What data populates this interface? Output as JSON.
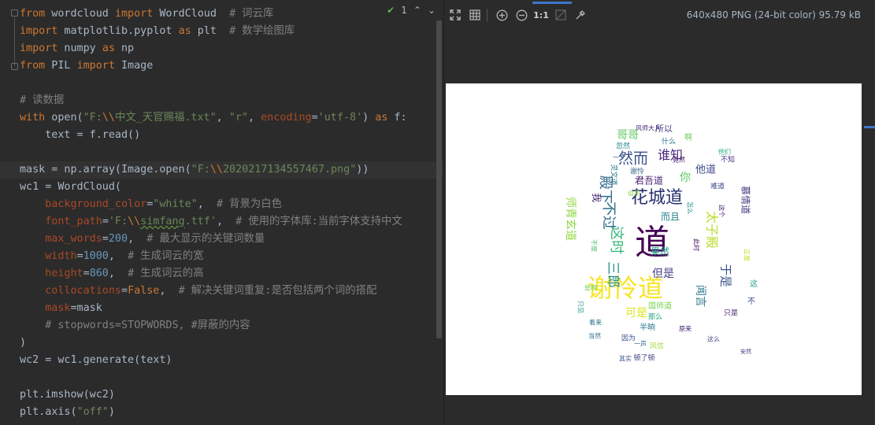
{
  "editor": {
    "code_lines": [
      [
        {
          "t": "from",
          "c": "k"
        },
        {
          "t": " wordcloud ",
          "c": ""
        },
        {
          "t": "import",
          "c": "k"
        },
        {
          "t": " WordCloud  ",
          "c": ""
        },
        {
          "t": "# 词云库",
          "c": "c"
        }
      ],
      [
        {
          "t": "import",
          "c": "k"
        },
        {
          "t": " matplotlib.pyplot ",
          "c": ""
        },
        {
          "t": "as",
          "c": "k"
        },
        {
          "t": " plt  ",
          "c": ""
        },
        {
          "t": "# 数学绘图库",
          "c": "c"
        }
      ],
      [
        {
          "t": "import",
          "c": "k"
        },
        {
          "t": " numpy ",
          "c": ""
        },
        {
          "t": "as",
          "c": "k"
        },
        {
          "t": " np",
          "c": ""
        }
      ],
      [
        {
          "t": "from",
          "c": "k"
        },
        {
          "t": " PIL ",
          "c": ""
        },
        {
          "t": "import",
          "c": "k"
        },
        {
          "t": " Image",
          "c": ""
        }
      ],
      [],
      [
        {
          "t": "# 读数据",
          "c": "c"
        }
      ],
      [
        {
          "t": "with",
          "c": "k"
        },
        {
          "t": " open(",
          "c": ""
        },
        {
          "t": "\"F:",
          "c": "s"
        },
        {
          "t": "\\\\",
          "c": "k"
        },
        {
          "t": "中文_天官赐福.txt\"",
          "c": "s"
        },
        {
          "t": ", ",
          "c": ""
        },
        {
          "t": "\"r\"",
          "c": "s"
        },
        {
          "t": ", ",
          "c": ""
        },
        {
          "t": "encoding",
          "c": "p"
        },
        {
          "t": "=",
          "c": ""
        },
        {
          "t": "'utf-8'",
          "c": "s"
        },
        {
          "t": ") ",
          "c": ""
        },
        {
          "t": "as",
          "c": "k"
        },
        {
          "t": " f:",
          "c": ""
        }
      ],
      [
        {
          "t": "    text = f.read()",
          "c": ""
        }
      ],
      [],
      [
        {
          "t": "mask = np.array(Image.open(",
          "c": ""
        },
        {
          "t": "\"F:",
          "c": "s"
        },
        {
          "t": "\\\\",
          "c": "k"
        },
        {
          "t": "2020217134557467.png\"",
          "c": "s"
        },
        {
          "t": "))",
          "c": ""
        }
      ],
      [
        {
          "t": "wc1 = WordCloud(",
          "c": ""
        }
      ],
      [
        {
          "t": "    ",
          "c": ""
        },
        {
          "t": "background_color",
          "c": "p"
        },
        {
          "t": "=",
          "c": ""
        },
        {
          "t": "\"white\"",
          "c": "s"
        },
        {
          "t": ",  ",
          "c": ""
        },
        {
          "t": "# 背景为白色",
          "c": "c"
        }
      ],
      [
        {
          "t": "    ",
          "c": ""
        },
        {
          "t": "font_path",
          "c": "p"
        },
        {
          "t": "=",
          "c": ""
        },
        {
          "t": "'F:",
          "c": "s"
        },
        {
          "t": "\\\\",
          "c": "k"
        },
        {
          "t": "simfang",
          "c": "su"
        },
        {
          "t": ".ttf'",
          "c": "s"
        },
        {
          "t": ",  ",
          "c": ""
        },
        {
          "t": "# 使用的字体库:当前字体支持中文",
          "c": "c"
        }
      ],
      [
        {
          "t": "    ",
          "c": ""
        },
        {
          "t": "max_words",
          "c": "p"
        },
        {
          "t": "=",
          "c": ""
        },
        {
          "t": "200",
          "c": "n"
        },
        {
          "t": ",  ",
          "c": ""
        },
        {
          "t": "# 最大显示的关键词数量",
          "c": "c"
        }
      ],
      [
        {
          "t": "    ",
          "c": ""
        },
        {
          "t": "width",
          "c": "p"
        },
        {
          "t": "=",
          "c": ""
        },
        {
          "t": "1000",
          "c": "n"
        },
        {
          "t": ",  ",
          "c": ""
        },
        {
          "t": "# 生成词云的宽",
          "c": "c"
        }
      ],
      [
        {
          "t": "    ",
          "c": ""
        },
        {
          "t": "height",
          "c": "p"
        },
        {
          "t": "=",
          "c": ""
        },
        {
          "t": "860",
          "c": "n"
        },
        {
          "t": ",  ",
          "c": ""
        },
        {
          "t": "# 生成词云的高",
          "c": "c"
        }
      ],
      [
        {
          "t": "    ",
          "c": ""
        },
        {
          "t": "collocations",
          "c": "p"
        },
        {
          "t": "=",
          "c": ""
        },
        {
          "t": "False",
          "c": "k"
        },
        {
          "t": ",  ",
          "c": ""
        },
        {
          "t": "# 解决关键词重复:是否包括两个词的搭配",
          "c": "c"
        }
      ],
      [
        {
          "t": "    ",
          "c": ""
        },
        {
          "t": "mask",
          "c": "p"
        },
        {
          "t": "=mask",
          "c": ""
        }
      ],
      [
        {
          "t": "    # stopwords=STOPWORDS, #屏蔽的内容",
          "c": "c"
        }
      ],
      [
        {
          "t": ")",
          "c": ""
        }
      ],
      [
        {
          "t": "wc2 = wc1.generate(text)",
          "c": ""
        }
      ],
      [],
      [
        {
          "t": "plt.imshow(wc2)",
          "c": ""
        }
      ],
      [
        {
          "t": "plt.axis(",
          "c": ""
        },
        {
          "t": "\"off\"",
          "c": "s"
        },
        {
          "t": ")",
          "c": ""
        }
      ]
    ],
    "inspection_count": "1"
  },
  "viewer": {
    "image_info": "640x480 PNG (24-bit color) 95.79 kB",
    "zoom_actual_label": "1:1",
    "wordcloud_words": [
      {
        "t": "道",
        "s": 44,
        "color": "#440154"
      },
      {
        "t": "谢怜道",
        "s": 32,
        "color": "#f7e425"
      },
      {
        "t": "花城道",
        "s": 22,
        "color": "#26306f"
      },
      {
        "t": "然而",
        "s": 19,
        "color": "#3b528b"
      },
      {
        "t": "不过",
        "s": 18,
        "color": "#2c718e"
      },
      {
        "t": "这时",
        "s": 18,
        "color": "#35b779"
      },
      {
        "t": "殿下",
        "s": 18,
        "color": "#31688e"
      },
      {
        "t": "谁知",
        "s": 16,
        "color": "#472a7a"
      },
      {
        "t": "太子殿",
        "s": 16,
        "color": "#b5de2b"
      },
      {
        "t": "三郎",
        "s": 17,
        "color": "#21918c"
      },
      {
        "t": "师青玄道",
        "s": 14,
        "color": "#90d743"
      },
      {
        "t": "哥哥",
        "s": 14,
        "color": "#5ec962"
      },
      {
        "t": "君吾道",
        "s": 12,
        "color": "#482173"
      },
      {
        "t": "于是",
        "s": 15,
        "color": "#3b528b"
      },
      {
        "t": "闻言",
        "s": 14,
        "color": "#2a788e"
      },
      {
        "t": "但是",
        "s": 14,
        "color": "#433e85"
      },
      {
        "t": "可是",
        "s": 14,
        "color": "#dde318"
      },
      {
        "t": "而且",
        "s": 12,
        "color": "#26828e"
      },
      {
        "t": "你",
        "s": 14,
        "color": "#5ec962"
      },
      {
        "t": "我",
        "s": 12,
        "color": "#482878"
      },
      {
        "t": "他道",
        "s": 13,
        "color": "#3e4989"
      },
      {
        "t": "果然",
        "s": 12,
        "color": "#1f9e89"
      },
      {
        "t": "所以",
        "s": 11,
        "color": "#443a83"
      },
      {
        "t": "国师道",
        "s": 10,
        "color": "#7ad151"
      },
      {
        "t": "半晌",
        "s": 10,
        "color": "#2a788e"
      },
      {
        "t": "顿了顿",
        "s": 9,
        "color": "#414487"
      },
      {
        "t": "风师大人",
        "s": 8,
        "color": "#472c7a"
      },
      {
        "t": "灵文道",
        "s": 9,
        "color": "#287c8e"
      },
      {
        "t": "谢怜",
        "s": 9,
        "color": "#355f8d"
      },
      {
        "t": "那么",
        "s": 9,
        "color": "#22a884"
      },
      {
        "t": "只是",
        "s": 9,
        "color": "#482475"
      },
      {
        "t": "因为",
        "s": 9,
        "color": "#3a548c"
      },
      {
        "t": "风信",
        "s": 9,
        "color": "#9fda3a"
      },
      {
        "t": "什么",
        "s": 9,
        "color": "#2d708e"
      },
      {
        "t": "不知",
        "s": 9,
        "color": "#46327e"
      },
      {
        "t": "这",
        "s": 10,
        "color": "#1fa188"
      },
      {
        "t": "啊",
        "s": 10,
        "color": "#6ccd5a"
      },
      {
        "t": "忽然",
        "s": 9,
        "color": "#24868e"
      },
      {
        "t": "不",
        "s": 10,
        "color": "#3e4a89"
      },
      {
        "t": "安然",
        "s": 7,
        "color": "#472d7b"
      },
      {
        "t": "慕情道",
        "s": 12,
        "color": "#453581"
      },
      {
        "t": "难道",
        "s": 9,
        "color": "#3f4788"
      },
      {
        "t": "看来",
        "s": 8,
        "color": "#2c738e"
      },
      {
        "t": "只见",
        "s": 8,
        "color": "#1e9b8a"
      },
      {
        "t": "是啊",
        "s": 8,
        "color": "#73d056"
      },
      {
        "t": "竟然",
        "s": 8,
        "color": "#471164"
      },
      {
        "t": "正是",
        "s": 8,
        "color": "#c0df25"
      },
      {
        "t": "当然",
        "s": 8,
        "color": "#2f6b8e"
      },
      {
        "t": "这个",
        "s": 8,
        "color": "#48186a"
      },
      {
        "t": "他们",
        "s": 8,
        "color": "#25ab82"
      },
      {
        "t": "一个",
        "s": 8,
        "color": "#34618d"
      },
      {
        "t": "不是",
        "s": 8,
        "color": "#4ac16d"
      },
      {
        "t": "原来",
        "s": 8,
        "color": "#482979"
      },
      {
        "t": "其实",
        "s": 8,
        "color": "#38588c"
      },
      {
        "t": "怎么",
        "s": 8,
        "color": "#20928c"
      },
      {
        "t": "此时",
        "s": 8,
        "color": "#470d60"
      },
      {
        "t": "似乎",
        "s": 8,
        "color": "#8bd646"
      },
      {
        "t": "一声",
        "s": 8,
        "color": "#306a8e"
      },
      {
        "t": "这么",
        "s": 8,
        "color": "#3d4e8a"
      }
    ]
  }
}
